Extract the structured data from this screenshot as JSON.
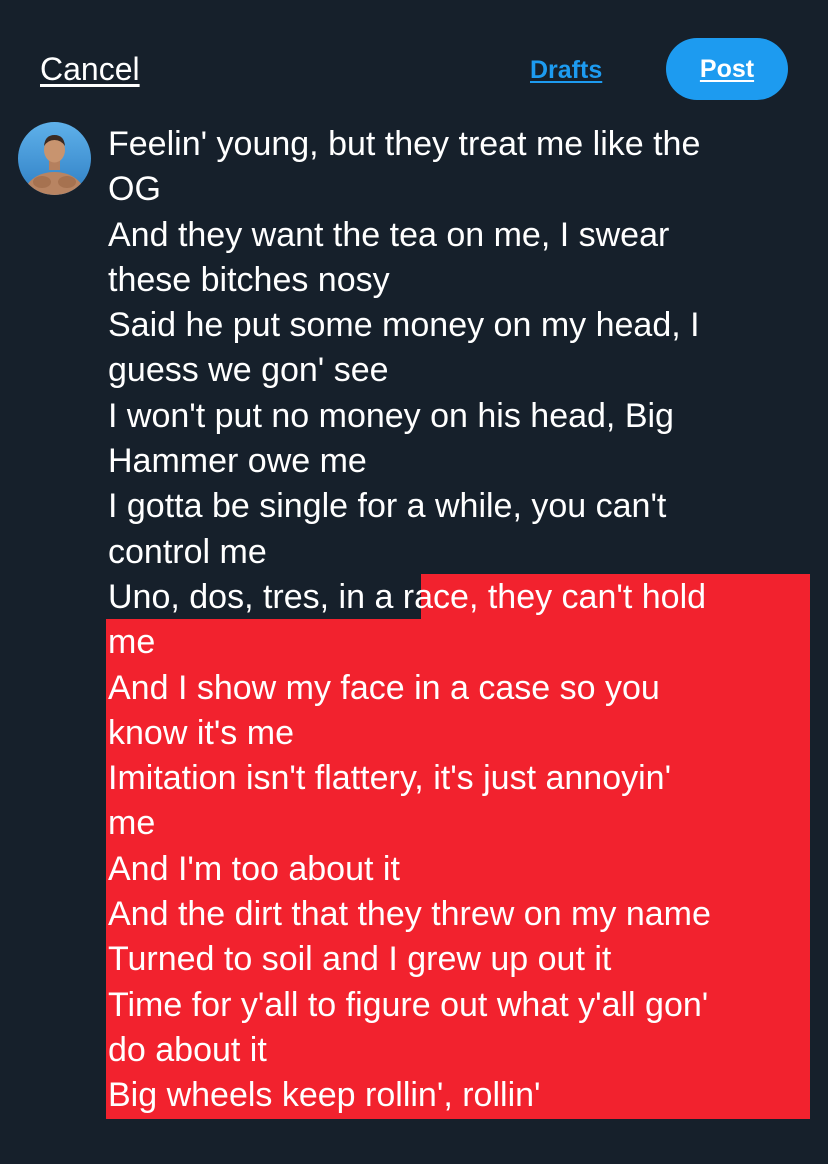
{
  "header": {
    "cancel_label": "Cancel",
    "drafts_label": "Drafts",
    "post_label": "Post"
  },
  "composer": {
    "lines": [
      "Feelin' young, but they treat me like the",
      "OG",
      "And they want the tea on me, I swear",
      "these bitches nosy",
      "Said he put some money on my head, I",
      "guess we gon' see",
      "I won't put no money on his head, Big",
      "Hammer owe me",
      "I gotta be single for a while, you can't",
      "control me",
      "Uno, dos, tres, in a race, they can't hold",
      "me",
      "And I show my face in a case so you",
      "know it's me",
      "Imitation isn't flattery, it's just annoyin'",
      "me",
      "And I'm too about it",
      "And the dirt that they threw on my name",
      "Turned to soil and I grew up out it",
      "Time for y'all to figure out what y'all gon'",
      "do about it",
      "Big wheels keep rollin', rollin'"
    ]
  },
  "colors": {
    "background": "#16202b",
    "accent": "#1d9bf0",
    "highlight": "#f2222e",
    "text": "#ffffff"
  },
  "icons": {
    "avatar": "profile-photo"
  }
}
